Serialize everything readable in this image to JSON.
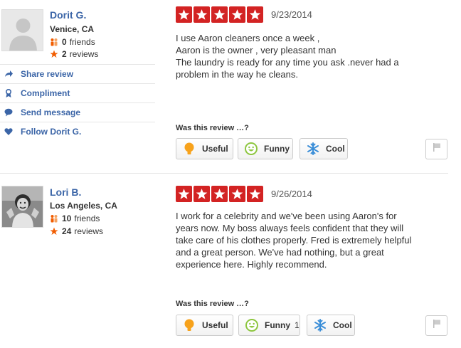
{
  "colors": {
    "star": "#d32323",
    "link": "#3b65a7"
  },
  "reviews": [
    {
      "user": {
        "name": "Dorit G.",
        "location": "Venice, CA",
        "friends_count": "0",
        "friends_label": "friends",
        "reviews_count": "2",
        "reviews_label": "reviews"
      },
      "actions": [
        {
          "label": "Share review",
          "icon": "share-arrow-icon"
        },
        {
          "label": "Compliment",
          "icon": "ribbon-icon"
        },
        {
          "label": "Send message",
          "icon": "speech-bubble-icon"
        },
        {
          "label": "Follow Dorit G.",
          "icon": "heart-icon"
        }
      ],
      "rating": 5,
      "date": "9/23/2014",
      "text": [
        "I use Aaron cleaners once a week ,",
        "Aaron is the owner , very pleasant man",
        "The laundry is ready for any time you ask .never had a",
        "problem in the way he cleans."
      ],
      "was_label": "Was this review …?",
      "votes": {
        "useful": "Useful",
        "funny": "Funny",
        "cool": "Cool",
        "funny_count": ""
      }
    },
    {
      "user": {
        "name": "Lori B.",
        "location": "Los Angeles, CA",
        "friends_count": "10",
        "friends_label": "friends",
        "reviews_count": "24",
        "reviews_label": "reviews"
      },
      "rating": 5,
      "date": "9/26/2014",
      "text": [
        "I work for a celebrity and we've been using Aaron's for",
        "years now.  My boss always feels confident that they will",
        "take care of his clothes properly.  Fred is extremely helpful",
        "and a great person.  We've had nothing, but a great",
        "experience here.  Highly recommend."
      ],
      "was_label": "Was this review …?",
      "votes": {
        "useful": "Useful",
        "funny": "Funny",
        "cool": "Cool",
        "funny_count": "1"
      }
    }
  ]
}
